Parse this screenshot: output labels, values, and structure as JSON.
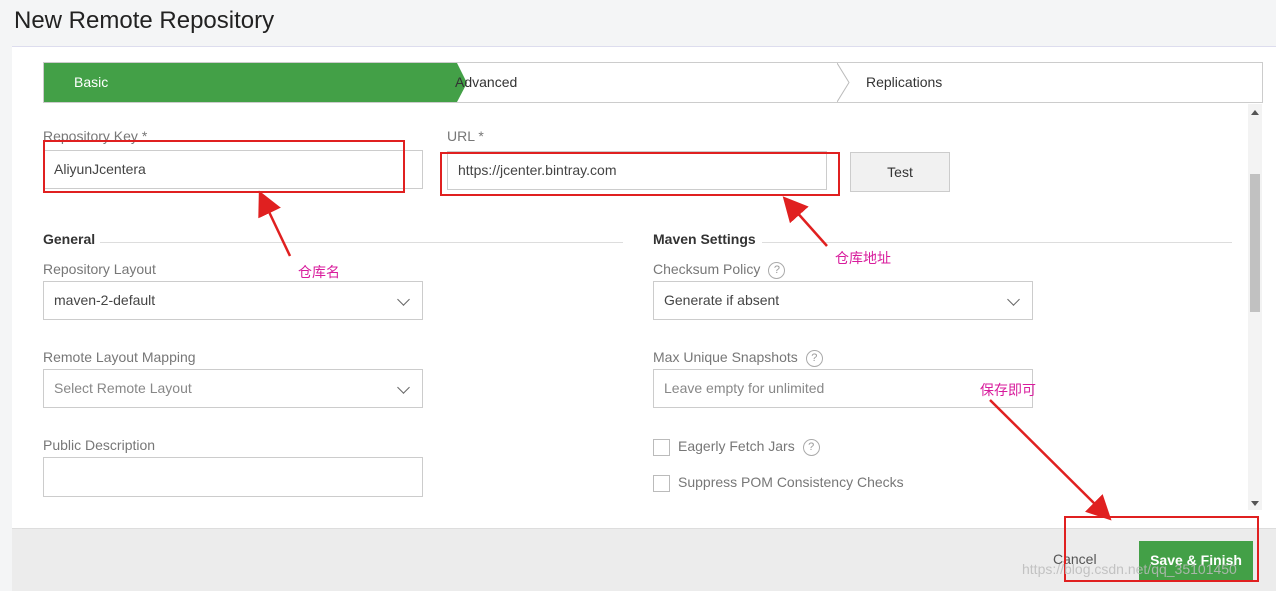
{
  "page_title": "New Remote Repository",
  "steps": [
    {
      "label": "Basic",
      "active": true
    },
    {
      "label": "Advanced",
      "active": false
    },
    {
      "label": "Replications",
      "active": false
    }
  ],
  "fields": {
    "repo_key": {
      "label": "Repository Key *",
      "value": "AliyunJcentera"
    },
    "url": {
      "label": "URL *",
      "value": "https://jcenter.bintray.com"
    },
    "test_button": "Test"
  },
  "general": {
    "title": "General",
    "repo_layout": {
      "label": "Repository Layout",
      "value": "maven-2-default"
    },
    "remote_layout": {
      "label": "Remote Layout Mapping",
      "placeholder": "Select Remote Layout"
    },
    "public_description": {
      "label": "Public Description",
      "value": ""
    }
  },
  "maven": {
    "title": "Maven Settings",
    "checksum_policy": {
      "label": "Checksum Policy",
      "value": "Generate if absent"
    },
    "max_snapshots": {
      "label": "Max Unique Snapshots",
      "placeholder": "Leave empty for unlimited"
    },
    "checkboxes": [
      {
        "label": "Eagerly Fetch Jars",
        "checked": false,
        "help": true
      },
      {
        "label": "Suppress POM Consistency Checks",
        "checked": false,
        "help": false
      }
    ]
  },
  "footer": {
    "cancel": "Cancel",
    "save": "Save & Finish"
  },
  "annotations": {
    "repo_name": "仓库名",
    "repo_url": "仓库地址",
    "save_hint": "保存即可"
  },
  "watermark": "https://blog.csdn.net/qq_35101450",
  "colors": {
    "accent": "#43a047",
    "annotation": "#d81b9c",
    "highlight": "#e02020"
  }
}
